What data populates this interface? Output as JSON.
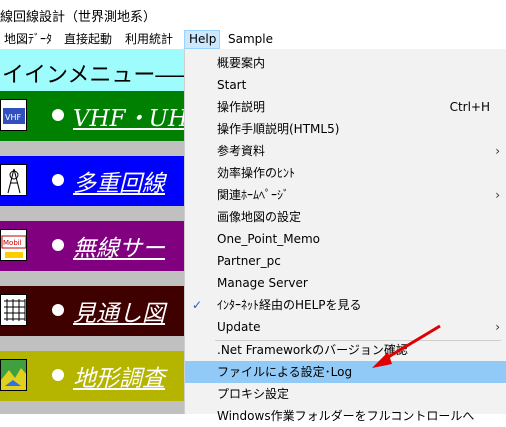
{
  "window": {
    "title": "線回線設計（世界測地系）"
  },
  "menubar": {
    "items": [
      {
        "label": "地図ﾃﾞｰﾀ"
      },
      {
        "label": "直接起動"
      },
      {
        "label": "利用統計"
      },
      {
        "label": "Help",
        "active": true
      },
      {
        "label": "Sample"
      }
    ]
  },
  "main_panel": {
    "heading": "イインメニュー――",
    "rows": [
      {
        "label": "VHF・UHF回",
        "color": "#008000",
        "icon": "vhf-uhf-icon",
        "icon_text": "VHF"
      },
      {
        "label": "多重回線",
        "color": "#0000ff",
        "icon": "antenna-tower-icon"
      },
      {
        "label": "無線サー",
        "color": "#800080",
        "icon": "mobile-icon",
        "icon_text": "Mobil"
      },
      {
        "label": "見通し図",
        "color": "#3f0000",
        "icon": "grid-chart-icon"
      },
      {
        "label": "地形調査",
        "color": "#b5b500",
        "icon": "terrain-map-icon"
      }
    ]
  },
  "help_menu": {
    "items": [
      {
        "label": "概要案内"
      },
      {
        "label": "Start"
      },
      {
        "label": "操作説明",
        "shortcut": "Ctrl+H"
      },
      {
        "label": "操作手順説明(HTML5)"
      },
      {
        "label": "参考資料",
        "submenu": true
      },
      {
        "label": "効率操作のﾋﾝﾄ"
      },
      {
        "label": "関連ﾎｰﾑﾍﾟｰｼﾞ",
        "submenu": true
      },
      {
        "label": "画像地図の設定"
      },
      {
        "label": "One_Point_Memo"
      },
      {
        "label": "Partner_pc"
      },
      {
        "label": "Manage Server"
      },
      {
        "label": "ｲﾝﾀｰﾈｯﾄ経由のHELPを見る",
        "checked": true
      },
      {
        "label": "Update",
        "submenu": true
      },
      {
        "label": ".Net Frameworkのバージョン確認"
      },
      {
        "label": "ファイルによる設定･Log",
        "highlighted": true
      },
      {
        "label": "プロキシ設定"
      },
      {
        "label": "Windows作業フォルダーをフルコントロールへ"
      }
    ]
  },
  "symbols": {
    "submenu_arrow": "›",
    "check": "✓"
  },
  "colors": {
    "menu_bg": "#f2f2f2",
    "highlight": "#91c9f7",
    "menubar_active": "#cce8ff",
    "annotation_arrow": "#e00000"
  }
}
